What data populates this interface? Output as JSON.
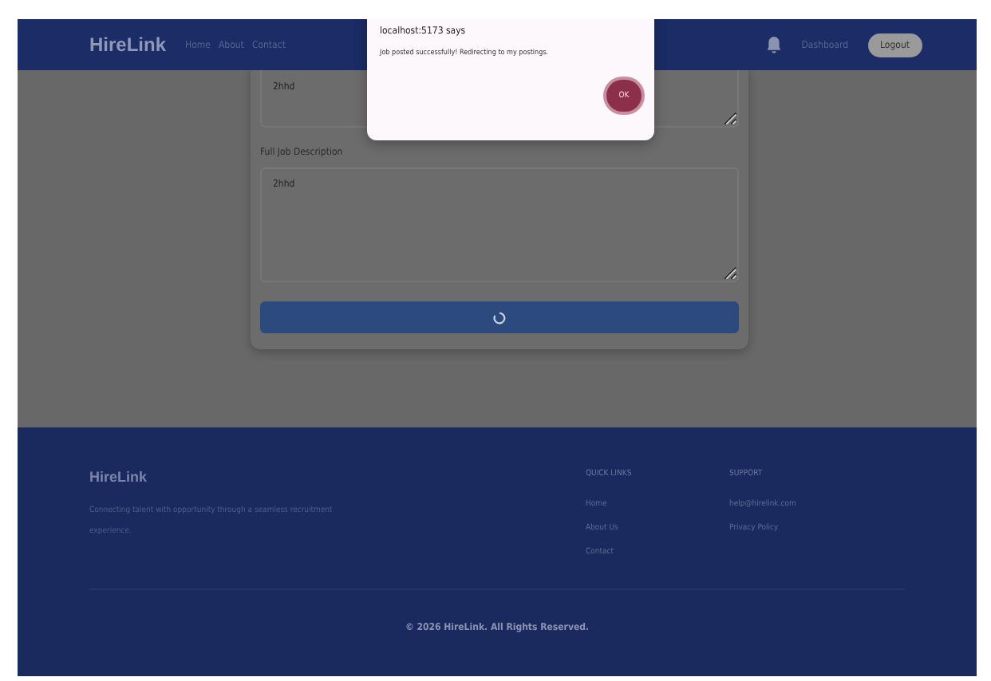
{
  "header": {
    "logo": "HireLink",
    "nav": [
      "Home",
      "About",
      "Contact"
    ],
    "dashboard": "Dashboard",
    "logout": "Logout"
  },
  "form": {
    "fields": [
      {
        "value": "2hhd"
      },
      {
        "label": "Full Job Description",
        "value": "2hhd"
      }
    ],
    "submit": {
      "loading": true
    }
  },
  "footer": {
    "brand": "HireLink",
    "tagline": "Connecting talent with opportunity through a seamless recruitment experience.",
    "columns": [
      {
        "heading": "QUICK LINKS",
        "links": [
          "Home",
          "About Us",
          "Contact"
        ]
      },
      {
        "heading": "SUPPORT",
        "links": [
          "help@hirelink.com",
          "Privacy Policy"
        ]
      }
    ],
    "copyright": "© 2026 HireLink. All Rights Reserved."
  },
  "dialog": {
    "title": "localhost:5173 says",
    "message": "Job posted successfully! Redirecting to my postings.",
    "button": "OK"
  }
}
